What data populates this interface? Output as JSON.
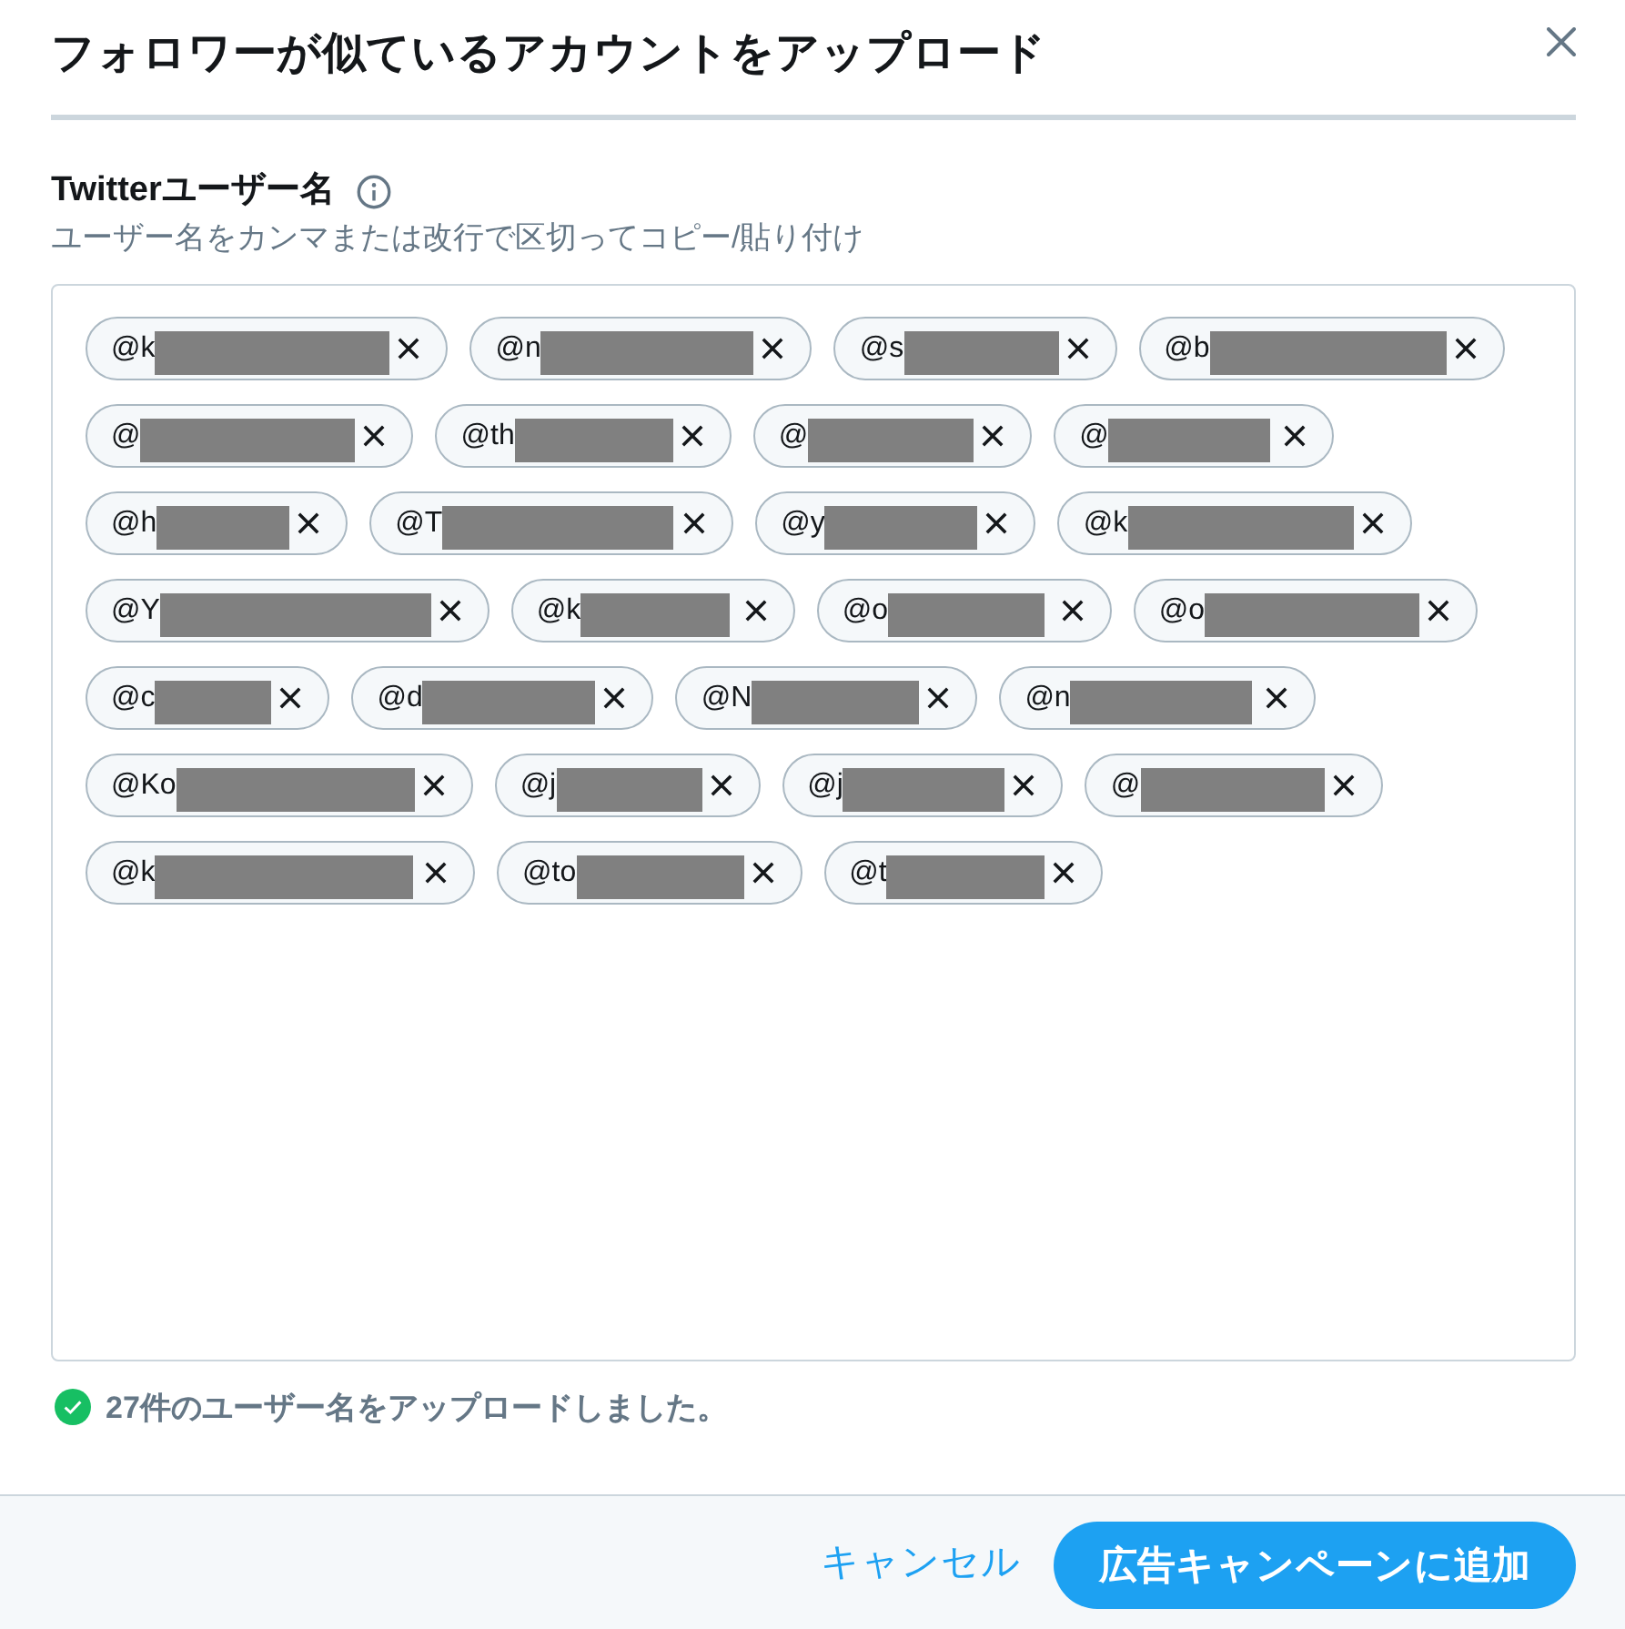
{
  "dialog": {
    "title": "フォロワーが似ているアカウントをアップロード"
  },
  "field": {
    "label": "Twitterユーザー名",
    "hint": "ユーザー名をカンマまたは改行で区切ってコピー/貼り付け",
    "chips": [
      {
        "text": "@k",
        "redacted": true
      },
      {
        "text": "@n",
        "redacted": true
      },
      {
        "text": "@s",
        "redacted": true
      },
      {
        "text": "@b",
        "redacted": true
      },
      {
        "text": "@",
        "redacted": true
      },
      {
        "text": "@th",
        "redacted": true
      },
      {
        "text": "@",
        "redacted": true
      },
      {
        "text": "@",
        "redacted": true
      },
      {
        "text": "@h",
        "redacted": true
      },
      {
        "text": "@T",
        "redacted": true
      },
      {
        "text": "@y",
        "redacted": true
      },
      {
        "text": "@k",
        "redacted": true
      },
      {
        "text": "@Y",
        "redacted": true
      },
      {
        "text": "@k",
        "redacted": true
      },
      {
        "text": "@o",
        "redacted": true
      },
      {
        "text": "@o",
        "redacted": true
      },
      {
        "text": "@c",
        "redacted": true
      },
      {
        "text": "@d",
        "redacted": true
      },
      {
        "text": "@N",
        "redacted": true
      },
      {
        "text": "@n",
        "redacted": true
      },
      {
        "text": "@Ko",
        "redacted": true
      },
      {
        "text": "@j",
        "redacted": true
      },
      {
        "text": "@j",
        "redacted": true
      },
      {
        "text": "@",
        "redacted": true
      },
      {
        "text": "@k",
        "redacted": true
      },
      {
        "text": "@to",
        "redacted": true
      },
      {
        "text": "@t",
        "redacted": true
      }
    ]
  },
  "status": {
    "kind": "success",
    "text": "27件のユーザー名をアップロードしました。"
  },
  "footer": {
    "cancel": "キャンセル",
    "submit": "広告キャンペーンに追加"
  }
}
